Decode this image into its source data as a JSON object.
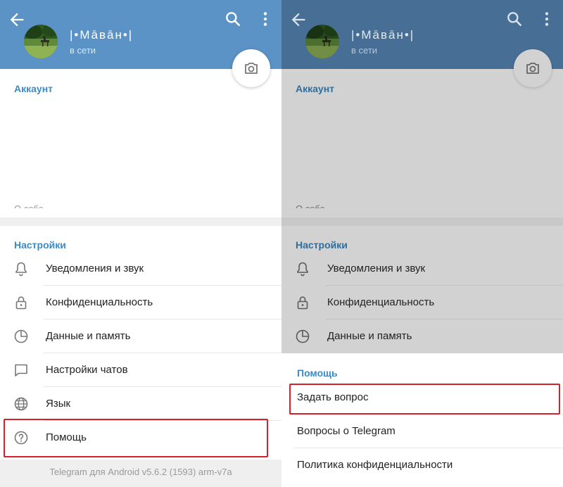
{
  "left": {
    "profile": {
      "name": "|•Māвāн•|",
      "status": "в сети"
    },
    "account_title": "Аккаунт",
    "about_label": "О себе",
    "settings_title": "Настройки",
    "items": [
      {
        "label": "Уведомления и звук",
        "icon": "bell-icon"
      },
      {
        "label": "Конфиденциальность",
        "icon": "lock-icon"
      },
      {
        "label": "Данные и память",
        "icon": "pie-chart-icon"
      },
      {
        "label": "Настройки чатов",
        "icon": "chat-bubble-icon"
      },
      {
        "label": "Язык",
        "icon": "globe-icon"
      },
      {
        "label": "Помощь",
        "icon": "question-icon"
      }
    ],
    "version": "Telegram для Android v5.6.2 (1593) arm-v7a"
  },
  "right": {
    "profile": {
      "name": "|•Māвāн•|",
      "status": "в сети"
    },
    "account_title": "Аккаунт",
    "about_label": "О себе",
    "settings_title": "Настройки",
    "items": [
      {
        "label": "Уведомления и звук",
        "icon": "bell-icon"
      },
      {
        "label": "Конфиденциальность",
        "icon": "lock-icon"
      },
      {
        "label": "Данные и память",
        "icon": "pie-chart-icon"
      }
    ],
    "help_sheet": {
      "title": "Помощь",
      "items": [
        {
          "label": "Задать вопрос"
        },
        {
          "label": "Вопросы о Telegram"
        },
        {
          "label": "Политика конфиденциальности"
        }
      ]
    }
  },
  "colors": {
    "header": "#5b93c7",
    "header_dimmed": "#476f95",
    "accent": "#3d8ac4",
    "highlight_border": "#d6202a"
  }
}
